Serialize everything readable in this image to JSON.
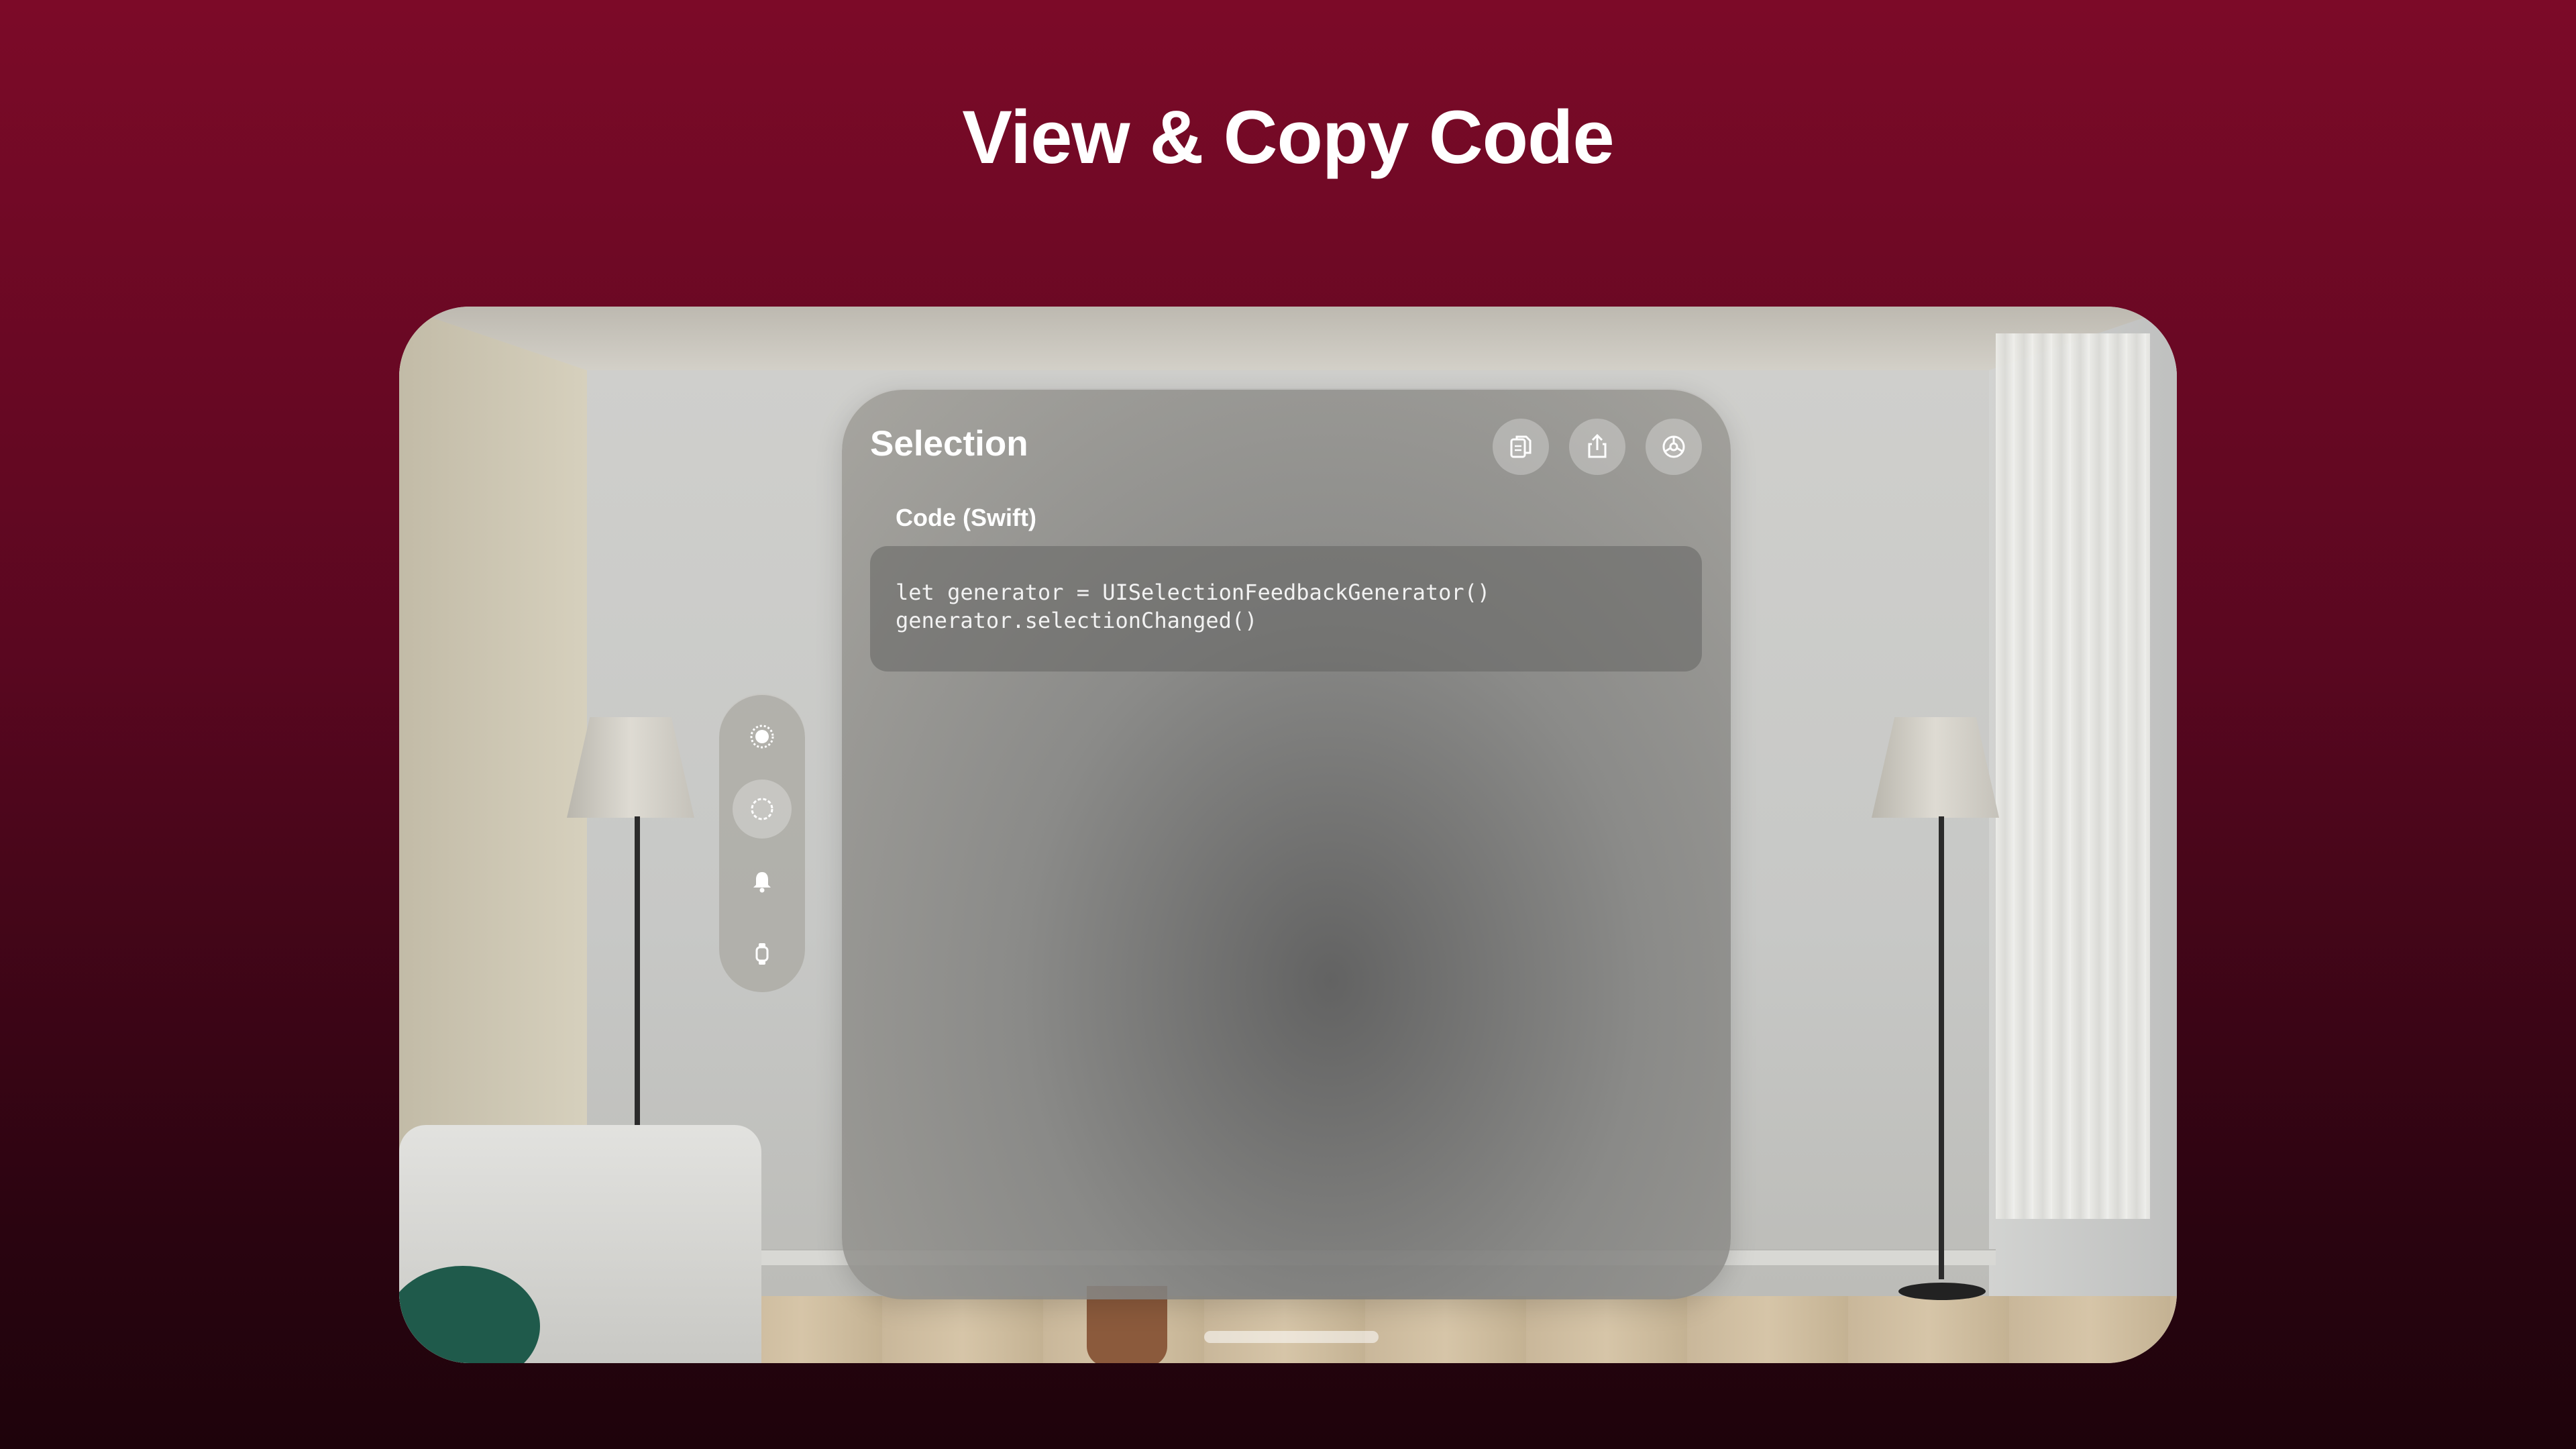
{
  "headline": "View & Copy Code",
  "window": {
    "title": "Selection",
    "toolbar": {
      "copy_icon": "copy-document-icon",
      "share_icon": "share-icon",
      "settings_icon": "settings-icon"
    },
    "section_label": "Code (Swift)",
    "code_lines": [
      "let generator = UISelectionFeedbackGenerator()",
      "generator.selectionChanged()"
    ]
  },
  "ornament": {
    "items": [
      {
        "icon": "haptic-impact-icon",
        "active": false
      },
      {
        "icon": "selection-circle-icon",
        "active": true
      },
      {
        "icon": "bell-icon",
        "active": false
      },
      {
        "icon": "watch-icon",
        "active": false
      }
    ]
  },
  "colors": {
    "background_top": "#7c0a28",
    "background_bottom": "#1e030b",
    "text": "#ffffff"
  }
}
